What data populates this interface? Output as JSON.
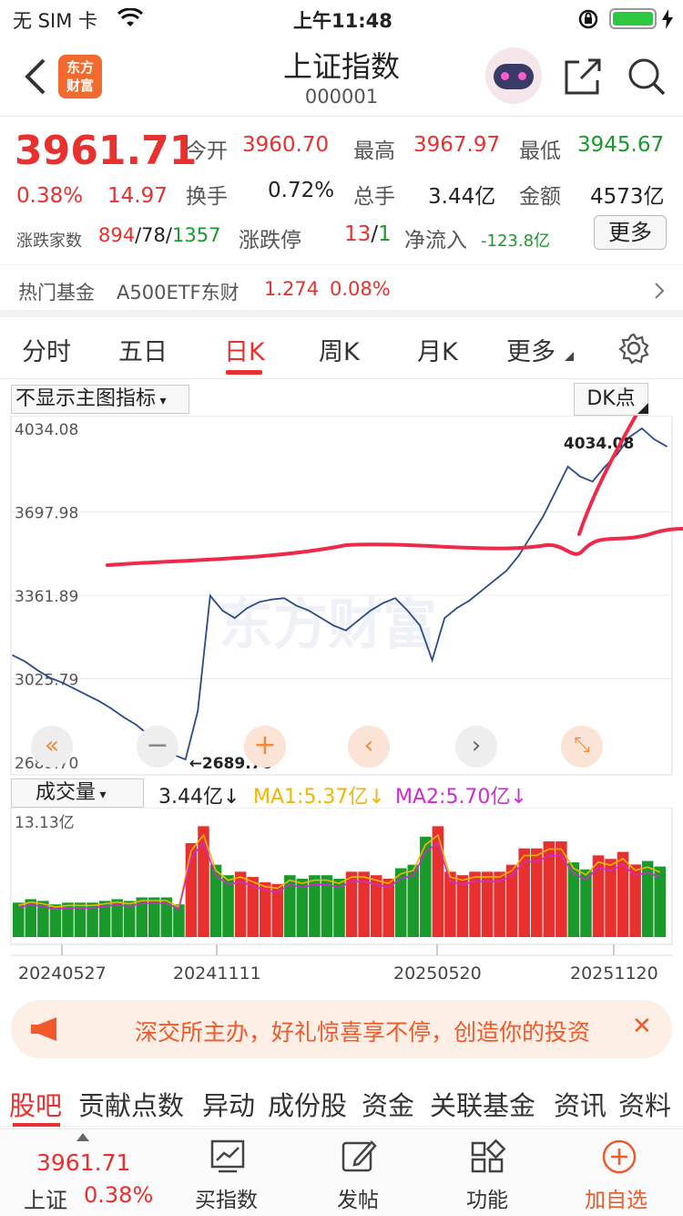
{
  "status": {
    "carrier": "无 SIM 卡",
    "time": "上午11:48",
    "wifi_icon": "wifi-icon",
    "lock_icon": "rotation-lock-icon",
    "battery_icon": "battery-charging-icon"
  },
  "nav": {
    "title": "上证指数",
    "code": "000001",
    "logo_line1": "东方",
    "logo_line2": "财富"
  },
  "quote": {
    "price": "3961.71",
    "change_pct": "0.38%",
    "change_val": "14.97",
    "open_label": "今开",
    "open": "3960.70",
    "high_label": "最高",
    "high": "3967.97",
    "low_label": "最低",
    "low": "3945.67",
    "turnover_label": "换手",
    "turnover": "0.72%",
    "volume_label": "总手",
    "volume": "3.44亿",
    "amount_label": "金额",
    "amount": "4573亿",
    "breadth_label": "涨跌家数",
    "up": "894",
    "sep1": "/",
    "flat": "78",
    "sep2": "/",
    "down": "1357",
    "limit_label": "涨跌停",
    "limit_up": "13",
    "sep3": "/",
    "limit_down": "1",
    "netflow_label": "净流入",
    "netflow": "-123.8亿",
    "more_label": "更多"
  },
  "fund": {
    "label": "热门基金",
    "name": "A500ETF东财",
    "price": "1.274",
    "pct": "0.08%"
  },
  "tabs": [
    "分时",
    "五日",
    "日K",
    "周K",
    "月K",
    "更多"
  ],
  "active_tab": 2,
  "chart": {
    "indicator_select": "不显示主图指标",
    "dk_label": "DK点",
    "watermark": "东方财富",
    "y_ticks": [
      "4034.08",
      "3697.98",
      "3361.89",
      "3025.79",
      "2689.70"
    ],
    "max_marker": "4034.08",
    "min_marker": "←2689.70",
    "volume_select": "成交量",
    "vol_now": "3.44亿↓",
    "ma1": "MA1:5.37亿↓",
    "ma2": "MA2:5.70亿↓",
    "vol_max": "13.13亿",
    "x_ticks": [
      "20240527",
      "20241111",
      "20250520",
      "20251120"
    ],
    "colors": {
      "up": "#e8302e",
      "down": "#1a9a2a",
      "line": "#2a4a8a",
      "ma1": "#f2b600",
      "ma2": "#d02ad0",
      "annotation": "#ee2a4a"
    }
  },
  "chart_data": {
    "type": "line",
    "x_range": [
      "20240527",
      "20251120"
    ],
    "ylim": [
      2689.7,
      4034.08
    ],
    "y": [
      3120,
      3095,
      3060,
      3030,
      3010,
      2985,
      2960,
      2935,
      2905,
      2870,
      2840,
      2800,
      2760,
      2720,
      2700,
      2895,
      3360,
      3300,
      3270,
      3310,
      3335,
      3345,
      3350,
      3320,
      3300,
      3270,
      3240,
      3220,
      3260,
      3300,
      3330,
      3350,
      3300,
      3240,
      3100,
      3270,
      3310,
      3340,
      3380,
      3420,
      3460,
      3520,
      3600,
      3680,
      3780,
      3880,
      3840,
      3820,
      3880,
      3930,
      4000,
      4034,
      3990,
      3961.71
    ],
    "annotations": [
      "red hand-drawn curves overlaid on chart"
    ]
  },
  "banner": {
    "text": "深交所主办，好礼惊喜享不停，创造你的投资",
    "close": "✕"
  },
  "subtabs": [
    "股吧",
    "贡献点数",
    "异动",
    "成份股",
    "资金",
    "关联基金",
    "资讯",
    "资料"
  ],
  "active_subtab": 0,
  "bottom": {
    "price": "3961.71",
    "name": "上证",
    "pct": "0.38%",
    "items": [
      "买指数",
      "发帖",
      "功能",
      "加自选"
    ]
  }
}
